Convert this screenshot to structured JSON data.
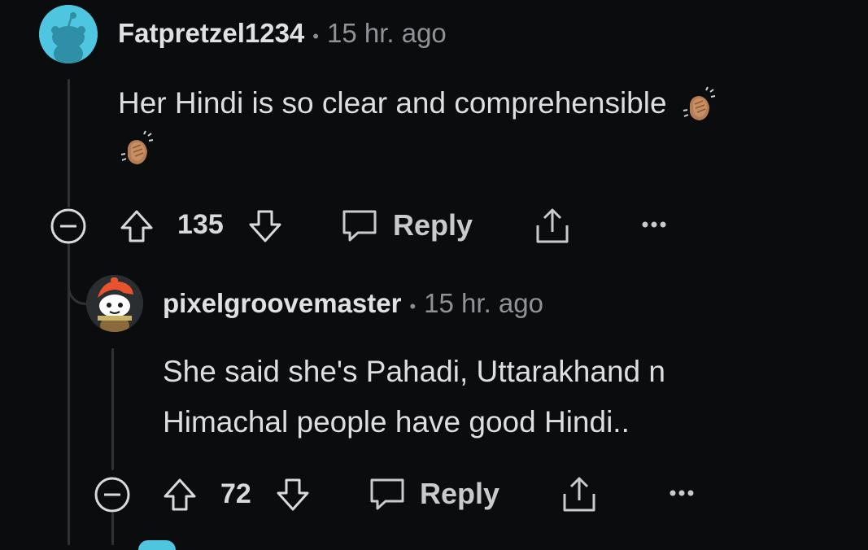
{
  "comments": [
    {
      "username": "Fatpretzel1234",
      "separator": "•",
      "time": "15 hr. ago",
      "body": "Her Hindi is so clear and comprehensible",
      "score": "135",
      "reply_label": "Reply",
      "avatar_icon": "snoo-avatar-cyan",
      "emoji": "clapping-hands-icon"
    },
    {
      "username": "pixelgroovemaster",
      "separator": "•",
      "time": "15 hr. ago",
      "body_line1": "She said she's Pahadi, Uttarakhand n",
      "body_line2": "Himachal people have good Hindi..",
      "score": "72",
      "reply_label": "Reply",
      "avatar_icon": "snoo-avatar-orange-cap"
    }
  ],
  "colors": {
    "background": "#0b0c0e",
    "text": "#d7dadc",
    "muted": "#8f9296",
    "thread_line": "#2f3234",
    "avatar_cyan": "#4fc6df"
  }
}
